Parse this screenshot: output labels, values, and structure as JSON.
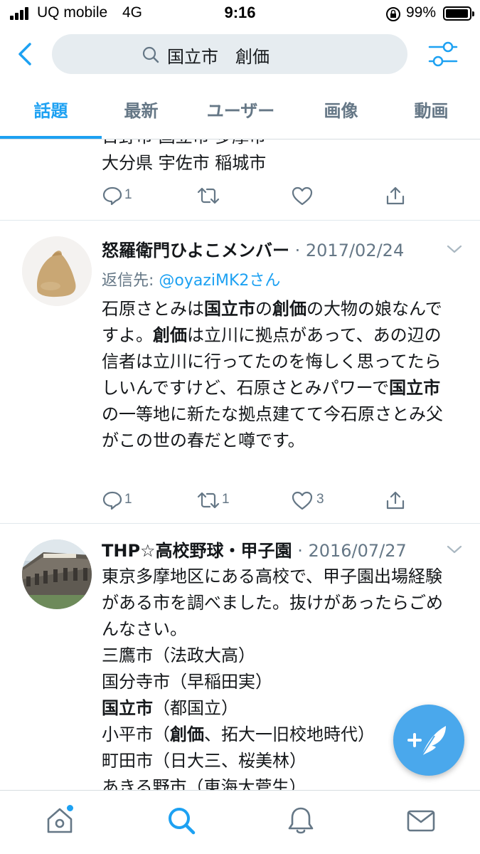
{
  "status_bar": {
    "carrier": "UQ mobile",
    "network": "4G",
    "time": "9:16",
    "battery": "99%"
  },
  "search": {
    "query": "国立市　創価"
  },
  "tabs": [
    {
      "label": "話題"
    },
    {
      "label": "最新"
    },
    {
      "label": "ユーザー"
    },
    {
      "label": "画像"
    },
    {
      "label": "動画"
    }
  ],
  "partial_tweet": {
    "line_top": "日野市 国立市 多摩市",
    "line_bottom": "大分県 宇佐市 稲城市",
    "reply_count": "1"
  },
  "tweets": [
    {
      "author": "怒羅衛門ひよこメンバー",
      "date": "2017/02/24",
      "reply_to_prefix": "返信先: ",
      "reply_to_handle": "@oyaziMK2さん",
      "reply_count": "1",
      "retweet_count": "1",
      "like_count": "3"
    },
    {
      "author": "THP☆高校野球・甲子園",
      "date": "2016/07/27"
    }
  ],
  "colors": {
    "accent": "#1da1f2",
    "muted": "#657786",
    "divider": "#e1e8ed",
    "search_bg": "#e6ecf0"
  },
  "icons": {
    "back": "chevron-left-icon",
    "filter": "sliders-icon",
    "reply": "speech-bubble-icon",
    "retweet": "retweet-icon",
    "like": "heart-icon",
    "share": "share-icon",
    "home": "home-icon",
    "search": "search-icon",
    "notifications": "bell-icon",
    "messages": "envelope-icon",
    "compose": "feather-plus-icon"
  }
}
